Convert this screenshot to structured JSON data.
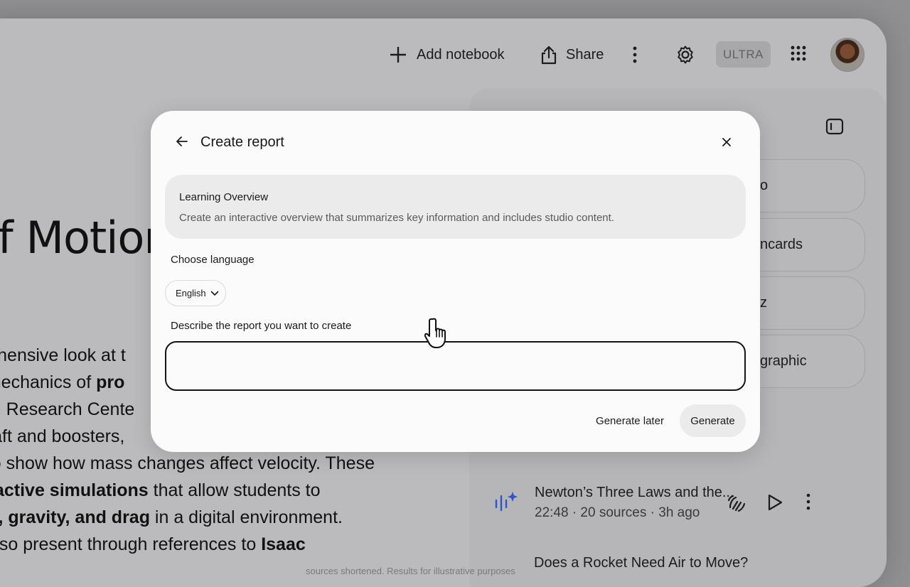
{
  "topbar": {
    "add_notebook": "Add notebook",
    "share": "Share",
    "plan_badge": "ULTRA"
  },
  "notebook": {
    "title_fragment": "of Motior",
    "lines": [
      {
        "pre": "prehensive look at t",
        "bold": "",
        "post": ""
      },
      {
        "pre": "e mechanics of ",
        "bold": "pro",
        "post": ""
      },
      {
        "pre": "enn Research Cente",
        "bold": "",
        "post": ""
      },
      {
        "pre": "rcraft and boosters,",
        "bold": "",
        "post": ""
      },
      {
        "pre": "n to show how mass changes affect velocity. These",
        "bold": "",
        "post": ""
      },
      {
        "pre": "",
        "bold": "teractive simulations",
        "post": " that allow students to"
      },
      {
        "pre": "",
        "bold": "ust, gravity, and drag",
        "post": " in a digital environment."
      },
      {
        "pre": "s also present through references to ",
        "bold": "Isaac",
        "post": ""
      }
    ]
  },
  "studio": {
    "buttons": [
      "o",
      "ncards",
      "z",
      "graphic"
    ]
  },
  "audio": {
    "title": "Newton’s Three Laws and the...",
    "meta": "22:48 · 20 sources · 3h ago",
    "next_title": "Does a Rocket Need Air to Move?"
  },
  "disclaimer": "sources shortened. Results for illustrative purposes",
  "modal": {
    "title": "Create report",
    "card_title": "Learning Overview",
    "card_desc": "Create an interactive overview that summarizes key information and includes studio content.",
    "language_label": "Choose language",
    "language_value": "English",
    "describe_label": "Describe the report you want to create",
    "describe_value": "",
    "describe_placeholder": "",
    "generate_later": "Generate later",
    "generate": "Generate"
  },
  "colors": {
    "overlay_bg": "#bbbbbd",
    "modal_bg": "#fbfbfb",
    "card_bg": "#ebebeb",
    "accent_wave": "#2f56c9"
  },
  "icons": [
    "plus-icon",
    "share-icon",
    "more-vert-icon",
    "gear-icon",
    "apps-grid-icon",
    "panel-toggle-icon",
    "back-arrow-icon",
    "close-icon",
    "chevron-down-icon",
    "audio-wave-icon",
    "interactive-icon",
    "play-icon",
    "hand-cursor-icon"
  ]
}
